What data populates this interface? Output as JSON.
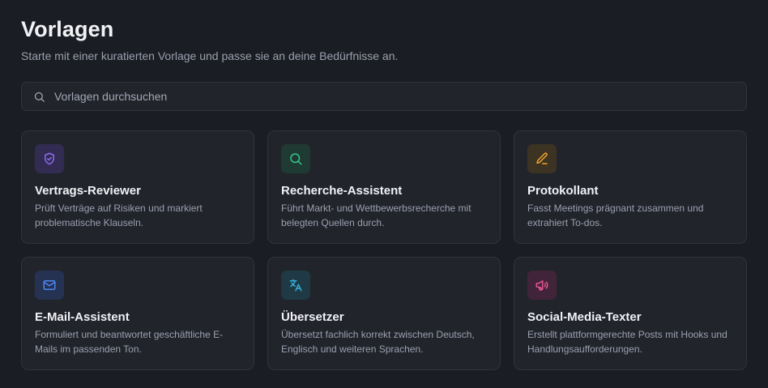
{
  "header": {
    "title": "Vorlagen",
    "subtitle": "Starte mit einer kuratierten Vorlage und passe sie an deine Bedürfnisse an."
  },
  "search": {
    "placeholder": "Vorlagen durchsuchen",
    "value": "",
    "icon": "search-icon"
  },
  "templates": [
    {
      "title": "Vertrags-Reviewer",
      "description": "Prüft Verträge auf Risiken und markiert problematische Klauseln.",
      "icon": "shield-icon",
      "icon_color": "#8b6cf0",
      "icon_bg": "#322b52"
    },
    {
      "title": "Recherche-Assistent",
      "description": "Führt Markt- und Wettbewerbsrecherche mit belegten Quellen durch.",
      "icon": "search-icon",
      "icon_color": "#34c48a",
      "icon_bg": "#1f3a32"
    },
    {
      "title": "Protokollant",
      "description": "Fasst Meetings prägnant zusammen und extrahiert To-dos.",
      "icon": "pencil-icon",
      "icon_color": "#f0a52a",
      "icon_bg": "#3d3323"
    },
    {
      "title": "E-Mail-Assistent",
      "description": "Formuliert und beantwortet geschäftliche E-Mails im passenden Ton.",
      "icon": "mail-icon",
      "icon_color": "#4f86f0",
      "icon_bg": "#253252"
    },
    {
      "title": "Übersetzer",
      "description": "Übersetzt fachlich korrekt zwischen Deutsch, Englisch und weiteren Sprachen.",
      "icon": "translate-icon",
      "icon_color": "#34b0d6",
      "icon_bg": "#1f3945"
    },
    {
      "title": "Social-Media-Texter",
      "description": "Erstellt plattformgerechte Posts mit Hooks und Handlungsaufforderungen.",
      "icon": "megaphone-icon",
      "icon_color": "#e0548f",
      "icon_bg": "#42243a"
    }
  ]
}
